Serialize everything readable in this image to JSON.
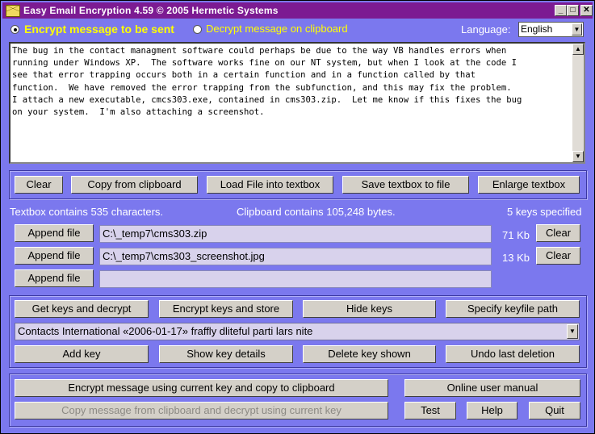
{
  "window": {
    "title": "Easy Email Encryption 4.59    © 2005 Hermetic Systems"
  },
  "mode": {
    "encrypt_label": "Encrypt message to be sent",
    "decrypt_label": "Decrypt message on clipboard",
    "selected": "encrypt"
  },
  "language": {
    "label": "Language:",
    "value": "English"
  },
  "textbox": {
    "content": "The bug in the contact managment software could perhaps be due to the way VB handles errors when\nrunning under Windows XP.  The software works fine on our NT system, but when I look at the code I\nsee that error trapping occurs both in a certain function and in a function called by that\nfunction.  We have removed the error trapping from the subfunction, and this may fix the problem.\nI attach a new executable, cmcs303.exe, contained in cms303.zip.  Let me know if this fixes the bug\non your system.  I'm also attaching a screenshot."
  },
  "toolbar": {
    "clear": "Clear",
    "copy_from_clipboard": "Copy from clipboard",
    "load_file": "Load File into textbox",
    "save_textbox": "Save textbox to file",
    "enlarge": "Enlarge textbox"
  },
  "status": {
    "textbox_count": "Textbox contains 535 characters.",
    "clipboard_count": "Clipboard contains 105,248 bytes.",
    "keys_specified": "5 keys specified"
  },
  "attachments": [
    {
      "button": "Append file",
      "path": "C:\\_temp7\\cms303.zip",
      "size": "71 Kb",
      "clear": "Clear"
    },
    {
      "button": "Append file",
      "path": "C:\\_temp7\\cms303_screenshot.jpg",
      "size": "13 Kb",
      "clear": "Clear"
    },
    {
      "button": "Append file",
      "path": "",
      "size": "",
      "clear": ""
    }
  ],
  "keys": {
    "get_keys": "Get keys and decrypt",
    "encrypt_keys": "Encrypt keys and store",
    "hide_keys": "Hide keys",
    "keyfile_path": "Specify keyfile path",
    "current_key": "Contacts International «2006-01-17» fraffly dliteful parti lars nite",
    "add_key": "Add key",
    "show_details": "Show key details",
    "delete_key": "Delete key shown",
    "undo_delete": "Undo last deletion"
  },
  "actions": {
    "encrypt_copy": "Encrypt message using current key and copy to clipboard",
    "decrypt_clipboard": "Copy message from clipboard and decrypt using current key",
    "manual": "Online user manual",
    "test": "Test",
    "help": "Help",
    "quit": "Quit"
  },
  "colors": {
    "window_bg": "#7b78ee",
    "titlebar": "#7c1b92",
    "accent_text": "#ffff00",
    "field_bg": "#d8d2ec"
  }
}
